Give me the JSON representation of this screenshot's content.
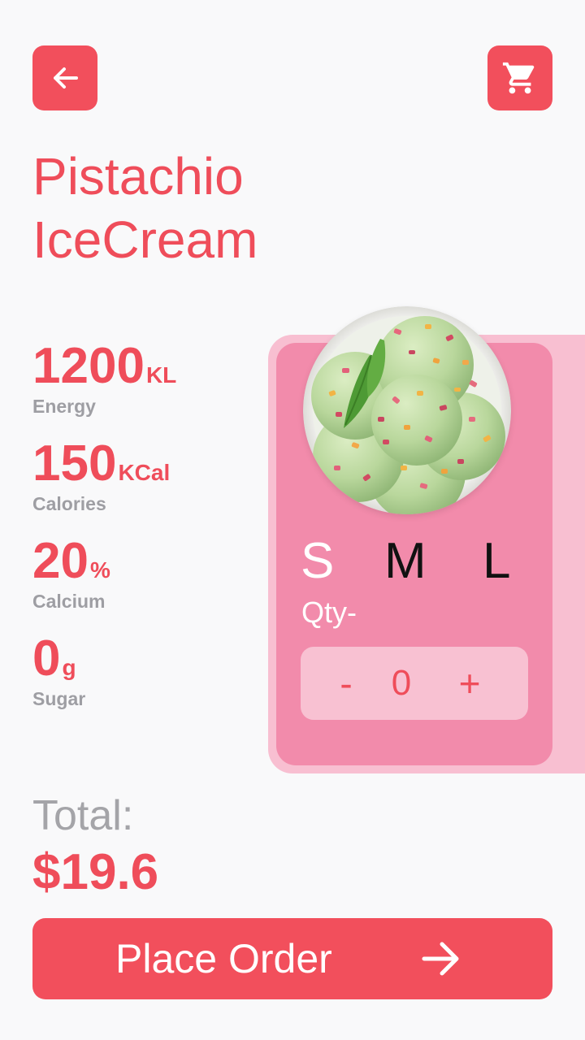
{
  "header": {
    "back_icon": "arrow-left-icon",
    "cart_icon": "shopping-cart-icon"
  },
  "product": {
    "title_line1": "Pistachio",
    "title_line2": "IceCream",
    "image": "pistachio-ice-cream-bowl"
  },
  "stats": [
    {
      "value": "1200",
      "unit": "KL",
      "label": "Energy"
    },
    {
      "value": "150",
      "unit": "KCal",
      "label": "Calories"
    },
    {
      "value": "20",
      "unit": "%",
      "label": "Calcium"
    },
    {
      "value": "0",
      "unit": "g",
      "label": "Sugar"
    }
  ],
  "sizes": {
    "s": "S",
    "m": "M",
    "l": "L",
    "selected": "S"
  },
  "quantity": {
    "label": "Qty-",
    "minus": "-",
    "value": "0",
    "plus": "+"
  },
  "total": {
    "label": "Total:",
    "value": "$19.6"
  },
  "order_button": {
    "label": "Place Order",
    "icon": "arrow-right-icon"
  },
  "colors": {
    "accent": "#f24f5c",
    "card": "#f28bab",
    "card_outline": "#f8bfd1",
    "muted_text": "#9e9ea3",
    "background": "#f9f9fa"
  }
}
